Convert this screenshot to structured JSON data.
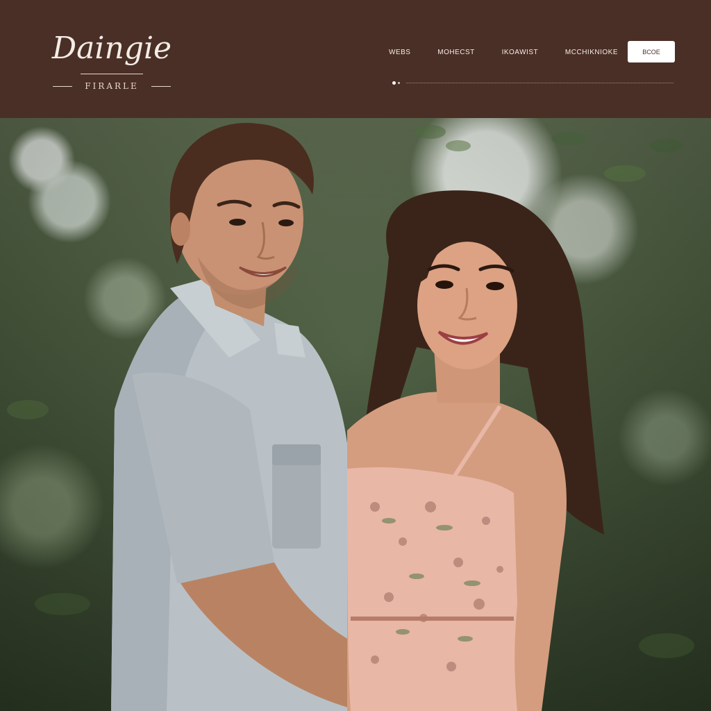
{
  "brand": {
    "name": "Daingie",
    "tagline": "FIRARLE"
  },
  "nav": {
    "items": [
      {
        "label": "WEBS"
      },
      {
        "label": "MOHECST"
      },
      {
        "label": "IKOAWIST"
      },
      {
        "label": "MCCHIKNIOKE"
      }
    ],
    "cta_label": "BCOE"
  },
  "hero": {
    "image_description": "couple-photo"
  },
  "colors": {
    "header_bg": "#4a2f26",
    "cta_bg": "#ffffff"
  }
}
